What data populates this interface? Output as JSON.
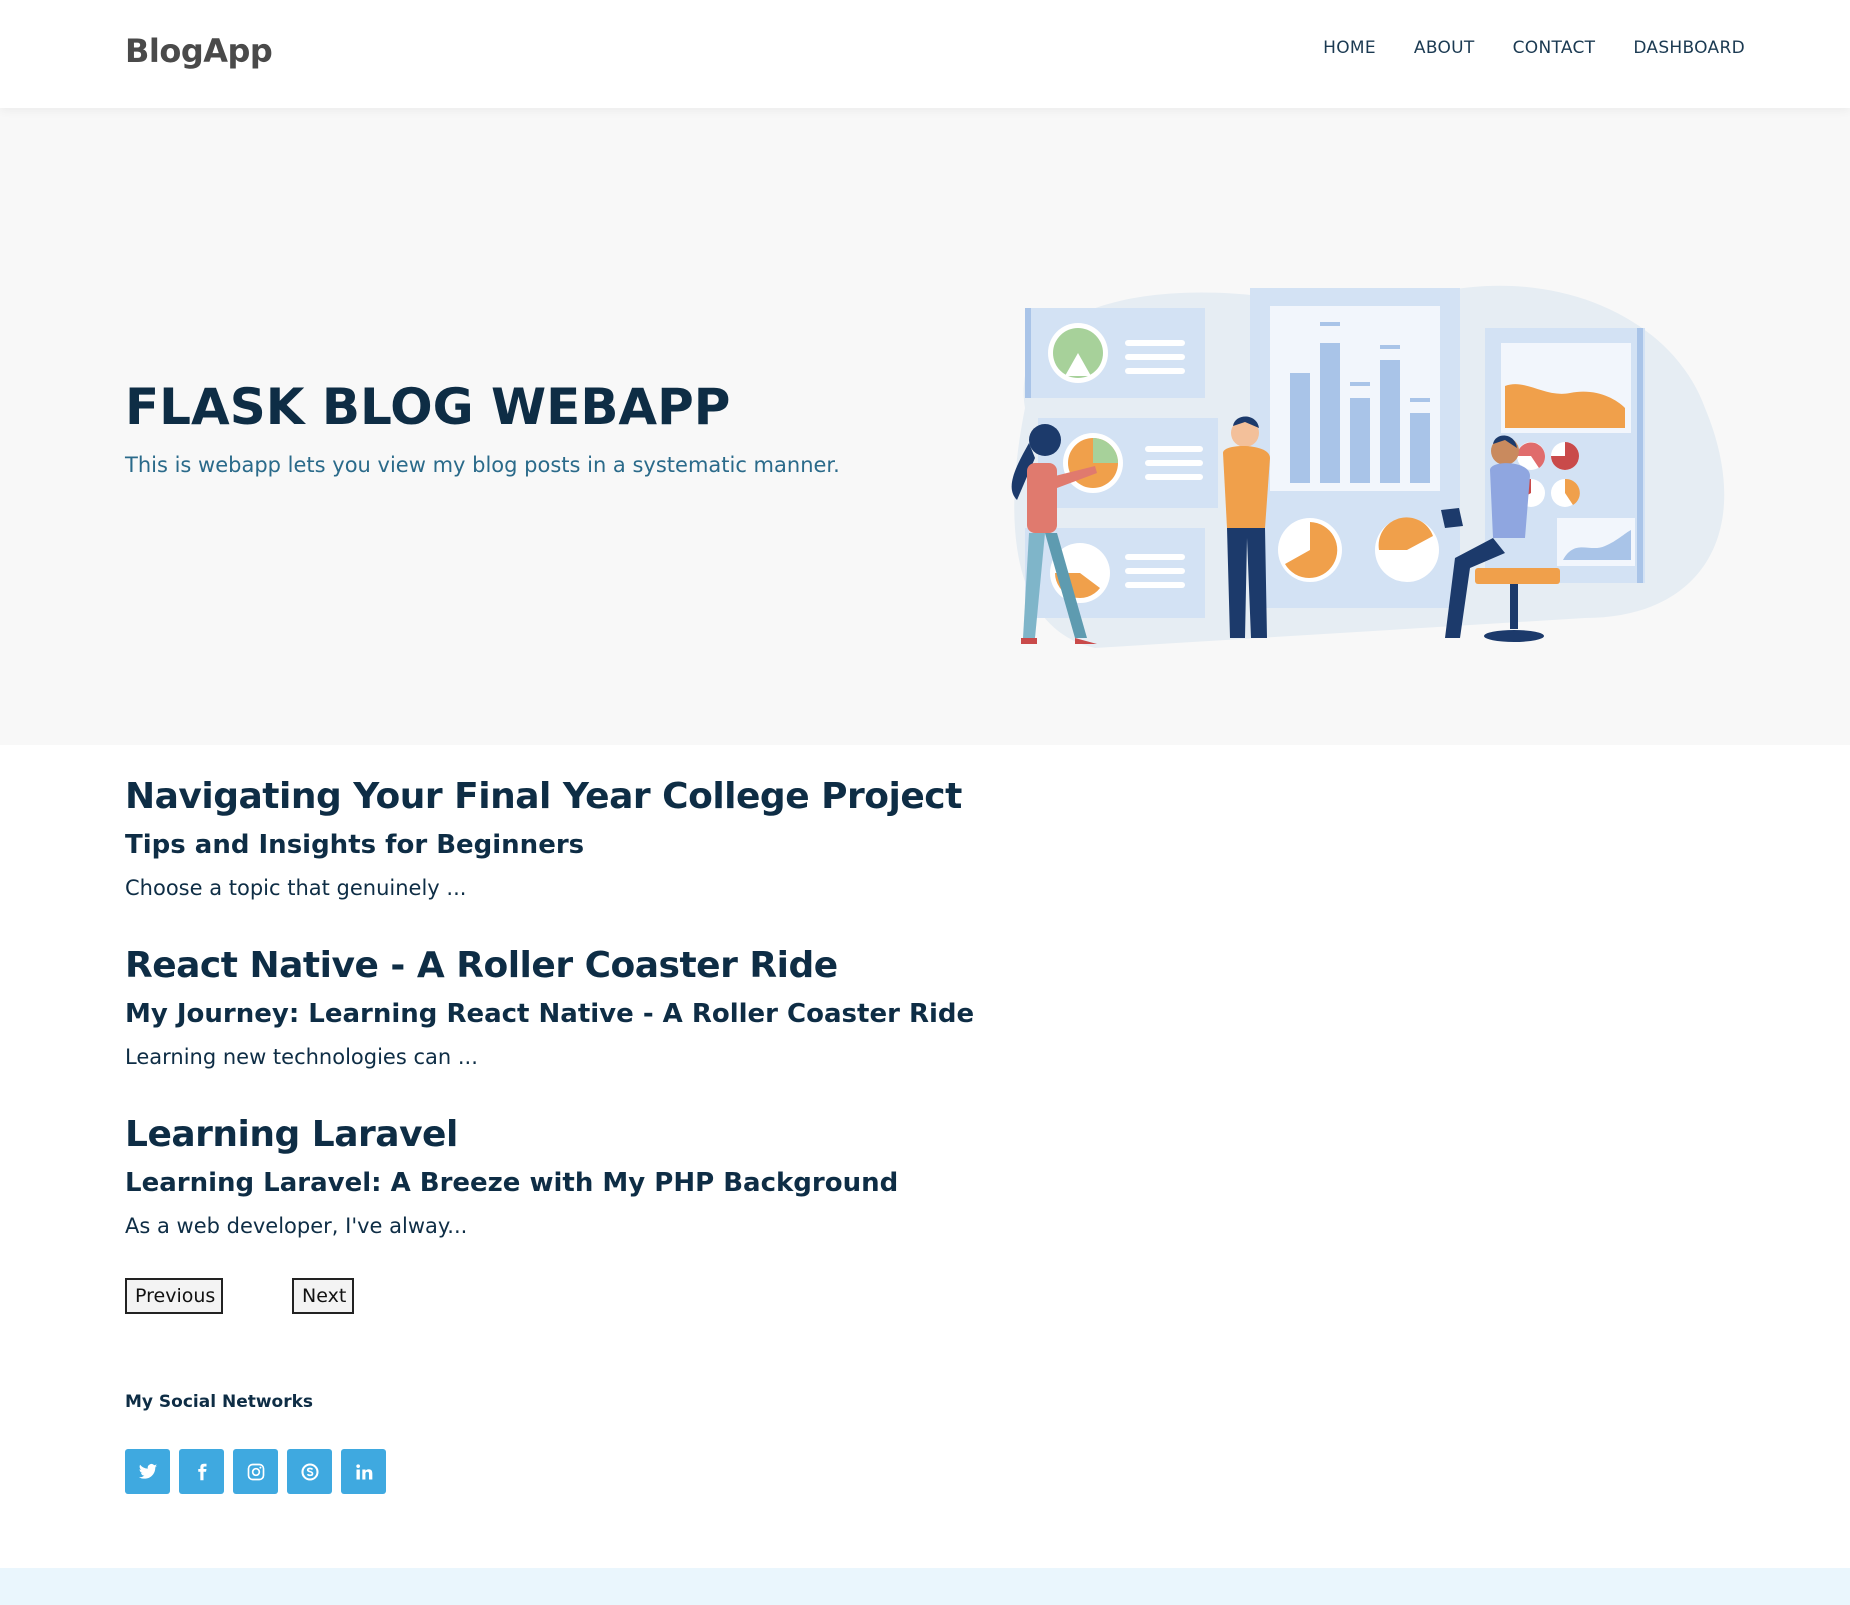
{
  "navbar": {
    "brand": "BlogApp",
    "links": [
      "HOME",
      "ABOUT",
      "CONTACT",
      "DASHBOARD"
    ]
  },
  "hero": {
    "title": "FLASK BLOG WEBAPP",
    "subtitle": "This is webapp lets you view my blog posts in a systematic manner."
  },
  "posts": [
    {
      "title": "Navigating Your Final Year College Project",
      "subtitle": "Tips and Insights for Beginners",
      "excerpt": "Choose a topic that genuinely ..."
    },
    {
      "title": "React Native - A Roller Coaster Ride",
      "subtitle": "My Journey: Learning React Native - A Roller Coaster Ride",
      "excerpt": "Learning new technologies can ..."
    },
    {
      "title": "Learning Laravel",
      "subtitle": "Learning Laravel: A Breeze with My PHP Background",
      "excerpt": "As a web developer, I've alway..."
    }
  ],
  "pager": {
    "previous": "Previous",
    "next": "Next"
  },
  "social": {
    "title": "My Social Networks",
    "icons": [
      "twitter-icon",
      "facebook-icon",
      "instagram-icon",
      "skype-icon",
      "linkedin-icon"
    ]
  },
  "colors": {
    "primary": "#0e2d45",
    "accent": "#3fa9e0",
    "hero_bg": "#f8f8f8",
    "footer_bg": "#eaf6fd"
  }
}
